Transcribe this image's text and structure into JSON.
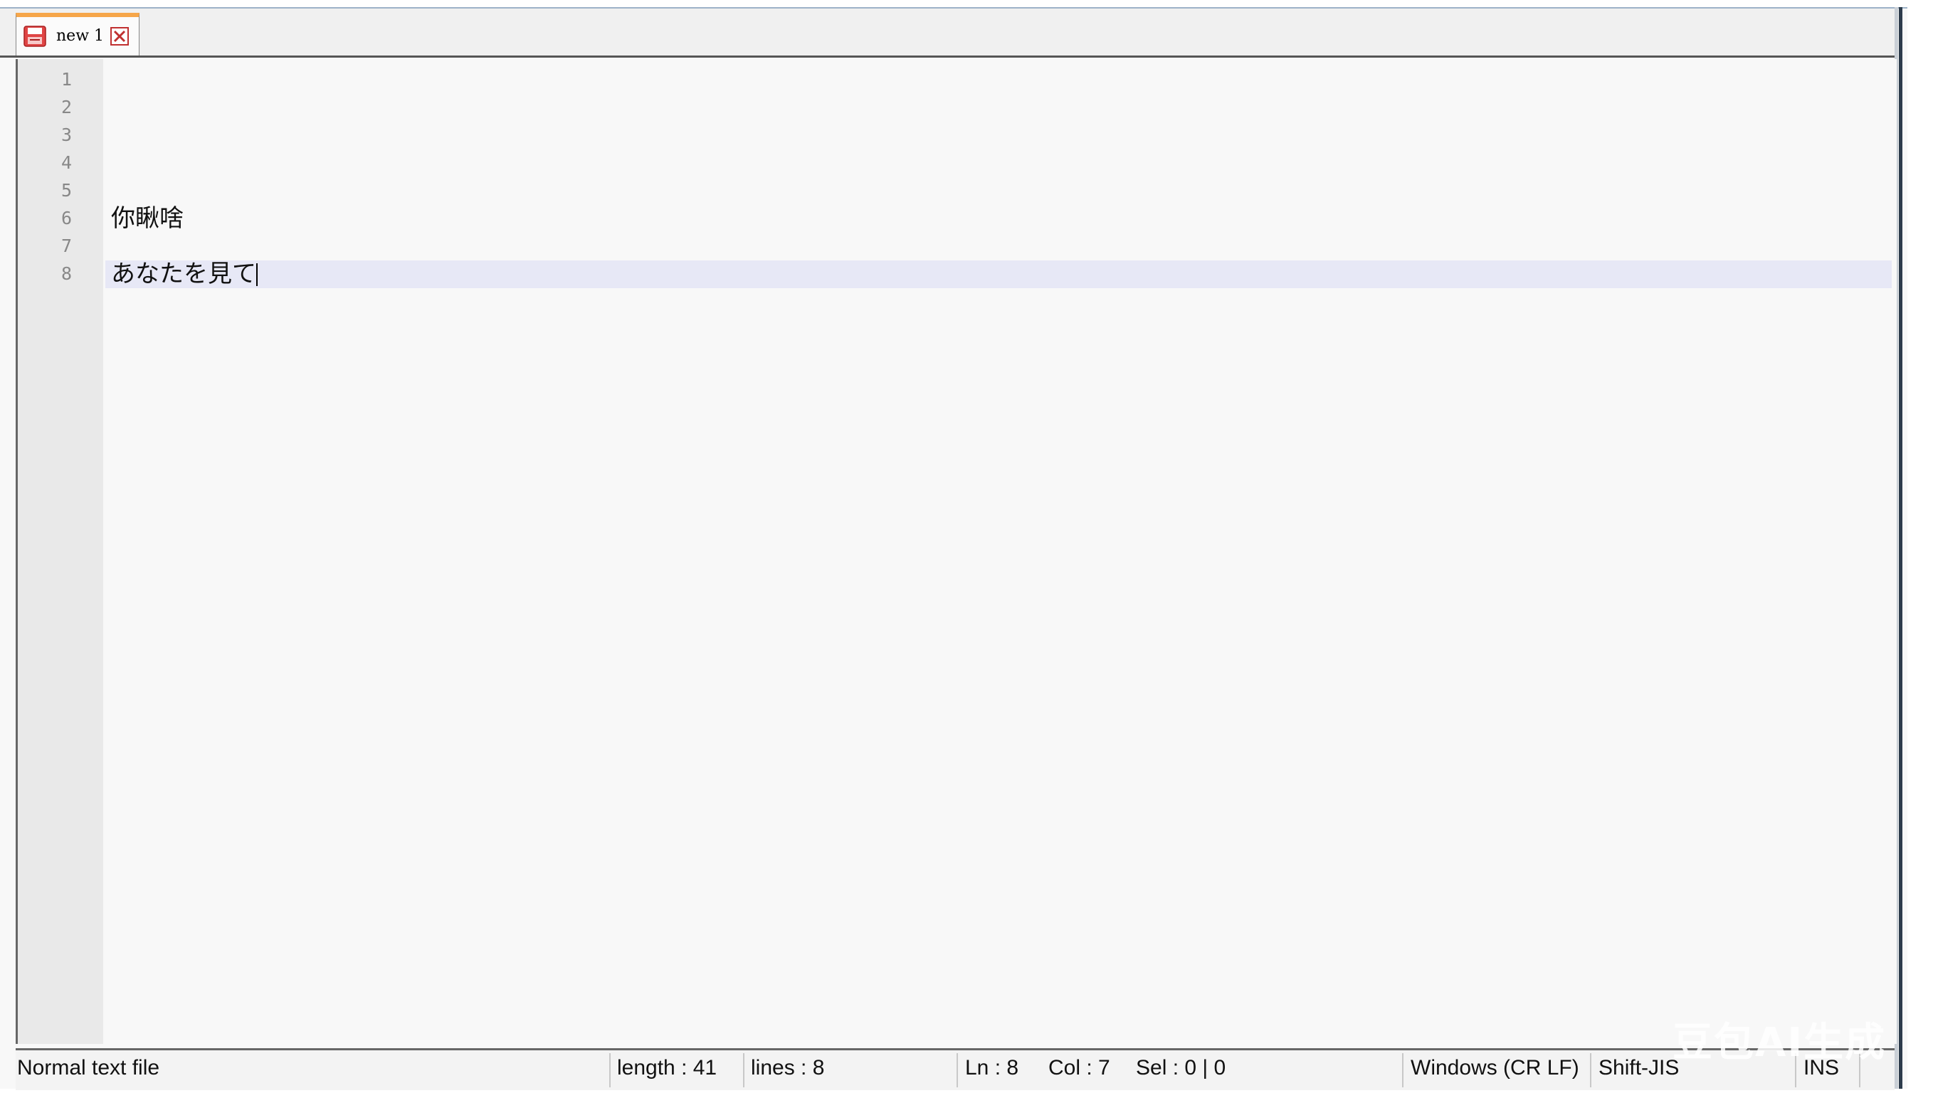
{
  "tab": {
    "label": "new 1",
    "icon": "unsaved-file-icon",
    "close_icon": "close-icon"
  },
  "editor": {
    "lines": [
      {
        "number": "1",
        "text": ""
      },
      {
        "number": "2",
        "text": ""
      },
      {
        "number": "3",
        "text": ""
      },
      {
        "number": "4",
        "text": ""
      },
      {
        "number": "5",
        "text": ""
      },
      {
        "number": "6",
        "text": "你瞅啥"
      },
      {
        "number": "7",
        "text": ""
      },
      {
        "number": "8",
        "text": "あなたを見て"
      }
    ],
    "current_line": 8,
    "current_line_color": "#e7e8f6"
  },
  "status": {
    "file_type": "Normal text file",
    "length": "length : 41",
    "lines": "lines : 8",
    "ln": "Ln : 8",
    "col": "Col : 7",
    "sel": "Sel : 0 | 0",
    "eol": "Windows (CR LF)",
    "encoding": "Shift-JIS",
    "mode": "INS"
  },
  "watermark": "豆包AI生成",
  "colors": {
    "tab_accent": "#f6a64a",
    "frame": "#2d3c4c"
  }
}
